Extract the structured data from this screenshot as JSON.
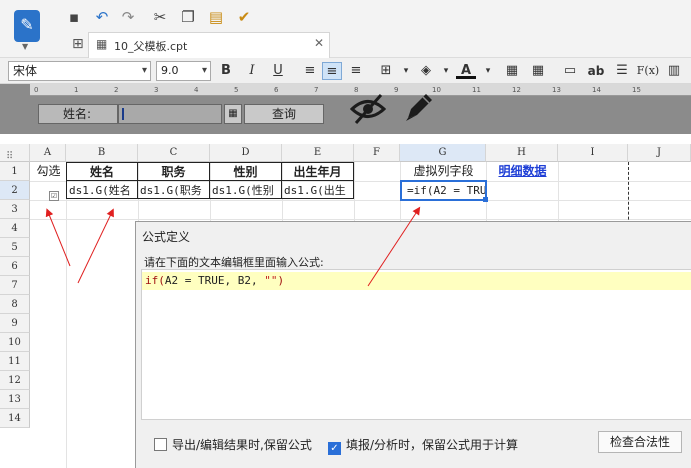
{
  "toolbar": {
    "app_logo": "report-designer-logo-icon",
    "icons": [
      "save-icon",
      "undo-icon",
      "redo-icon",
      "cut-icon",
      "copy-icon",
      "paste-icon",
      "format-painter-icon"
    ]
  },
  "tab": {
    "label": "10_父模板.cpt"
  },
  "format_bar": {
    "font": "宋体",
    "size": "9.0",
    "bold": "B",
    "italic": "I",
    "underline": "U",
    "text_style": "ab",
    "formula": "F(x)"
  },
  "param_panel": {
    "label": "姓名:",
    "query_button": "查询",
    "ruler_ticks": [
      "0",
      "1",
      "2",
      "3",
      "4",
      "5",
      "6",
      "7",
      "8",
      "9",
      "10",
      "11",
      "12",
      "13",
      "14",
      "15"
    ]
  },
  "grid": {
    "columns": [
      "A",
      "B",
      "C",
      "D",
      "E",
      "F",
      "G",
      "H",
      "I",
      "J"
    ],
    "rows": [
      "1",
      "2",
      "3",
      "4",
      "5",
      "6",
      "7",
      "8",
      "9",
      "10",
      "11",
      "12",
      "13",
      "14"
    ],
    "row1": {
      "A": "勾选",
      "B": "姓名",
      "C": "职务",
      "D": "性别",
      "E": "出生年月",
      "G": "虚拟列字段",
      "H": "明细数据"
    },
    "row2": {
      "B": "ds1.G(姓名",
      "C": "ds1.G(职务",
      "D": "ds1.G(性别",
      "E": "ds1.G(出生",
      "G": "=if(A2 = TRU"
    }
  },
  "formula_dialog": {
    "title": "公式定义",
    "prompt": "请在下面的文本编辑框里面输入公式:",
    "formula": {
      "func": "if",
      "open": "(",
      "args": "A2 = TRUE, B2, ",
      "literal": "\"\"",
      "close": ")"
    },
    "option_keep": "导出/编辑结果时,保留公式",
    "option_fill": "填报/分析时，保留公式用于计算",
    "option_keep_checked": false,
    "option_fill_checked": true,
    "check_button": "检查合法性"
  },
  "colors": {
    "accent": "#2a6fd8",
    "link": "#1f3fd6",
    "formula_highlight": "#ffffc0",
    "annotation": "#e02020"
  }
}
